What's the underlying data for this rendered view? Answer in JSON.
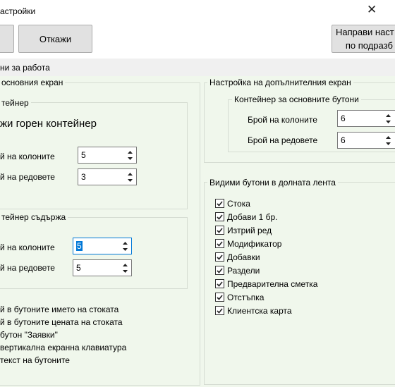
{
  "window": {
    "title": "астройки",
    "close_glyph": "✕"
  },
  "toolbar": {
    "left_button_label": "",
    "cancel_label": "Откажи",
    "right_button_line1": "Направи наст",
    "right_button_line2": "по подразб"
  },
  "settings_header": "ни за работа",
  "main_screen": {
    "title": "основния екран",
    "container": {
      "title": "тейнер",
      "show_top_label": "жи горен контейнер",
      "columns_label": "й на колоните",
      "columns_value": "5",
      "rows_label": "й на редовете",
      "rows_value": "3"
    },
    "content_container": {
      "title": "тейнер съдържа",
      "columns_label": "й на колоните",
      "columns_value": "5",
      "rows_label": "й на редовете",
      "rows_value": "5"
    },
    "options": [
      "й в бутоните името на стоката",
      "й в бутоните цената на стоката",
      "бутон \"Заявки\"",
      "вертикална екранна клавиатура",
      "текст на бутоните"
    ]
  },
  "extra_screen": {
    "title": "Настройка на допълнителния екран",
    "container": {
      "title": "Контейнер за основните бутони",
      "columns_label": "Брой на колоните",
      "columns_value": "6",
      "rows_label": "Брой на редовете",
      "rows_value": "6"
    }
  },
  "bottom_bar": {
    "title": "Видими бутони в долната лента",
    "items": [
      {
        "label": "Стока",
        "checked": true
      },
      {
        "label": "Добави 1 бр.",
        "checked": true
      },
      {
        "label": "Изтрий ред",
        "checked": true
      },
      {
        "label": "Модификатор",
        "checked": true
      },
      {
        "label": "Добавки",
        "checked": true
      },
      {
        "label": "Раздели",
        "checked": true
      },
      {
        "label": "Предварителна сметка",
        "checked": true
      },
      {
        "label": "Отстъпка",
        "checked": true
      },
      {
        "label": "Клиентска карта",
        "checked": true
      }
    ]
  }
}
